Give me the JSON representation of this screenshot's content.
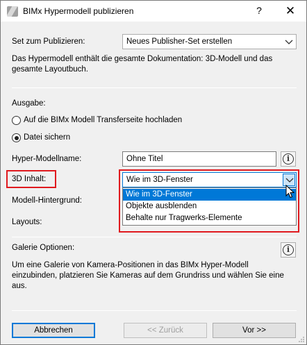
{
  "window": {
    "title": "BIMx Hypermodell publizieren",
    "help_glyph": "?",
    "close_glyph": "✕"
  },
  "publisher_set": {
    "label": "Set zum Publizieren:",
    "value": "Neues Publisher-Set erstellen",
    "description": "Das Hypermodell enthält die gesamte Dokumentation: 3D-Modell und das gesamte Layoutbuch."
  },
  "output": {
    "label": "Ausgabe:",
    "options": [
      {
        "label": "Auf die BIMx Modell Transferseite hochladen",
        "checked": false
      },
      {
        "label": "Datei sichern",
        "checked": true
      }
    ]
  },
  "hypermodel_name": {
    "label": "Hyper-Modellname:",
    "value": "Ohne Titel"
  },
  "content_3d": {
    "label": "3D Inhalt:",
    "value": "Wie im 3D-Fenster",
    "options": [
      "Wie im 3D-Fenster",
      "Objekte ausblenden",
      "Behalte nur Tragwerks-Elemente"
    ],
    "selected_index": 0
  },
  "model_background": {
    "label": "Modell-Hintergrund:"
  },
  "layouts": {
    "label": "Layouts:"
  },
  "gallery": {
    "label": "Galerie Optionen:",
    "description": "Um eine Galerie von Kamera-Positionen in das BIMx Hyper-Modell einzubinden, platzieren Sie Kameras auf dem Grundriss und wählen Sie eine aus."
  },
  "buttons": {
    "cancel": "Abbrechen",
    "back": "<< Zurück",
    "next": "Vor >>"
  },
  "colors": {
    "highlight_red": "#e0191e",
    "selection_blue": "#0078d7"
  }
}
